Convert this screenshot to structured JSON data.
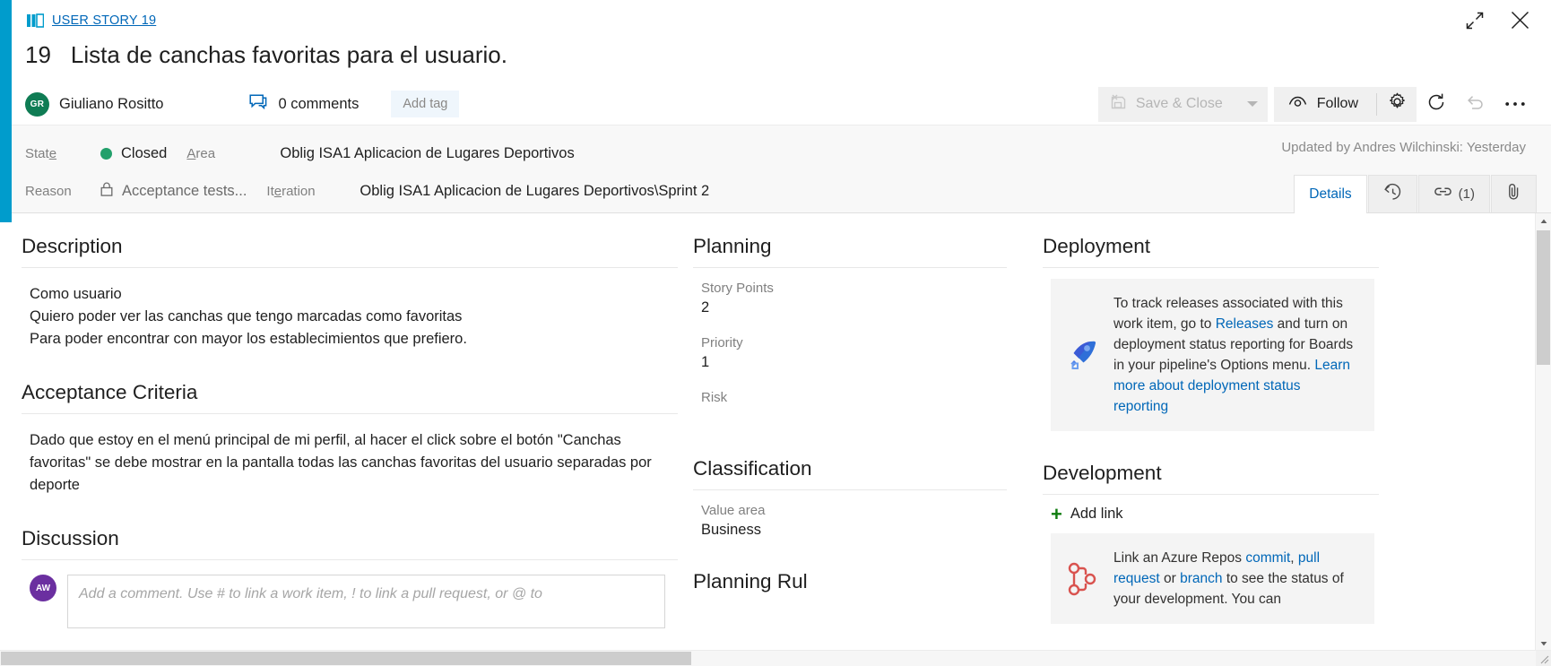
{
  "header": {
    "breadcrumb": "USER STORY 19",
    "work_item_id": "19",
    "title": "Lista de canchas favoritas para el usuario.",
    "assignee": "Giuliano Rositto",
    "assignee_initials": "GR",
    "comments": "0 comments",
    "add_tag": "Add tag"
  },
  "toolbar": {
    "save_close": "Save & Close",
    "follow": "Follow",
    "gear_icon": "gear-icon",
    "refresh_icon": "refresh-icon",
    "undo_icon": "undo-icon",
    "more_icon": "more-ellipsis-icon",
    "expand_icon": "expand-icon",
    "close_icon": "close-icon"
  },
  "fields": {
    "state_label": "State",
    "state_value": "Closed",
    "state_color": "#22a06b",
    "reason_label": "Reason",
    "reason_value": "Acceptance tests...",
    "area_label": "Area",
    "area_value": "Oblig ISA1 Aplicacion de Lugares Deportivos",
    "iteration_label": "Iteration",
    "iteration_value": "Oblig ISA1 Aplicacion de Lugares Deportivos\\Sprint 2",
    "updated_by": "Updated by Andres Wilchinski: Yesterday"
  },
  "tabs": [
    {
      "label": "Details",
      "icon": "",
      "count": "",
      "active": true
    },
    {
      "label": "",
      "icon": "history-icon",
      "count": "",
      "active": false
    },
    {
      "label": "",
      "icon": "link-icon",
      "count": "(1)",
      "active": false
    },
    {
      "label": "",
      "icon": "attachment-icon",
      "count": "",
      "active": false
    }
  ],
  "description": {
    "heading": "Description",
    "lines": [
      "Como usuario",
      "Quiero poder ver las canchas que tengo marcadas como favoritas",
      "Para poder encontrar con mayor los establecimientos que prefiero."
    ]
  },
  "acceptance": {
    "heading": "Acceptance Criteria",
    "text": "Dado que estoy en el menú principal de mi perfil, al hacer el click sobre el botón \"Canchas favoritas\" se debe mostrar en la pantalla todas las canchas favoritas del usuario separadas por deporte"
  },
  "discussion": {
    "heading": "Discussion",
    "avatar_initials": "AW",
    "comment_placeholder": "Add a comment. Use # to link a work item, ! to link a pull request, or @ to"
  },
  "planning": {
    "heading": "Planning",
    "story_points_label": "Story Points",
    "story_points_value": "2",
    "priority_label": "Priority",
    "priority_value": "1",
    "risk_label": "Risk",
    "risk_value": ""
  },
  "classification": {
    "heading": "Classification",
    "value_area_label": "Value area",
    "value_area_value": "Business"
  },
  "planning_rules": {
    "heading": "Planning Rul"
  },
  "deployment": {
    "heading": "Deployment",
    "icon": "rocket-icon",
    "text_1": "To track releases associated with this work item, go to ",
    "link_1": "Releases",
    "text_2": " and turn on deployment status reporting for Boards in your pipeline's Options menu. ",
    "link_2": "Learn more about deployment status reporting"
  },
  "development": {
    "heading": "Development",
    "add_link": "Add link",
    "icon": "repo-branch-icon",
    "text_1": "Link an Azure Repos ",
    "link_commit": "commit",
    "text_comma": ", ",
    "link_pr": "pull request",
    "text_or": " or ",
    "link_branch": "branch",
    "text_2": " to see the status of your development. You can"
  },
  "colors": {
    "accent": "#009ccc",
    "link": "#0067b8",
    "green": "#107c10",
    "state_green": "#22a06b"
  }
}
